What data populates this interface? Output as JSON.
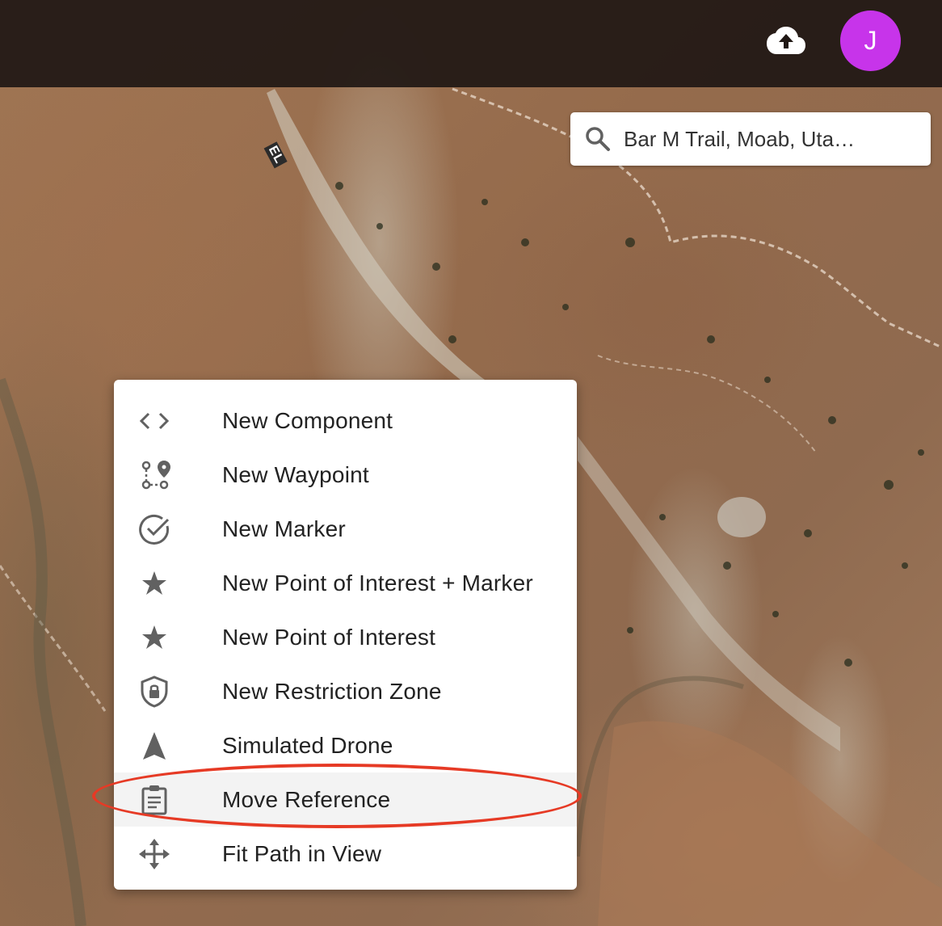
{
  "header": {
    "upload_icon": "cloud-upload-icon",
    "avatar_initial": "J",
    "avatar_color": "#c734ea"
  },
  "search": {
    "icon": "search-icon",
    "value": "Bar M Trail, Moab, Uta…"
  },
  "map": {
    "road_label": "EL"
  },
  "context_menu": {
    "items": [
      {
        "icon": "code-brackets-icon",
        "label": "New Component"
      },
      {
        "icon": "waypoint-route-icon",
        "label": "New Waypoint"
      },
      {
        "icon": "check-circle-icon",
        "label": "New Marker"
      },
      {
        "icon": "star-icon",
        "label": "New Point of Interest + Marker"
      },
      {
        "icon": "star-icon",
        "label": "New Point of Interest"
      },
      {
        "icon": "shield-lock-icon",
        "label": "New Restriction Zone"
      },
      {
        "icon": "navigation-arrow-icon",
        "label": "Simulated Drone"
      },
      {
        "icon": "clipboard-icon",
        "label": "Move Reference",
        "highlighted": true
      },
      {
        "icon": "move-arrows-icon",
        "label": "Fit Path in View"
      }
    ]
  },
  "colors": {
    "annotation": "#e63a25",
    "header_bg": "#201814",
    "highlight_bg": "#f3f3f3",
    "icon_gray": "#757575"
  }
}
